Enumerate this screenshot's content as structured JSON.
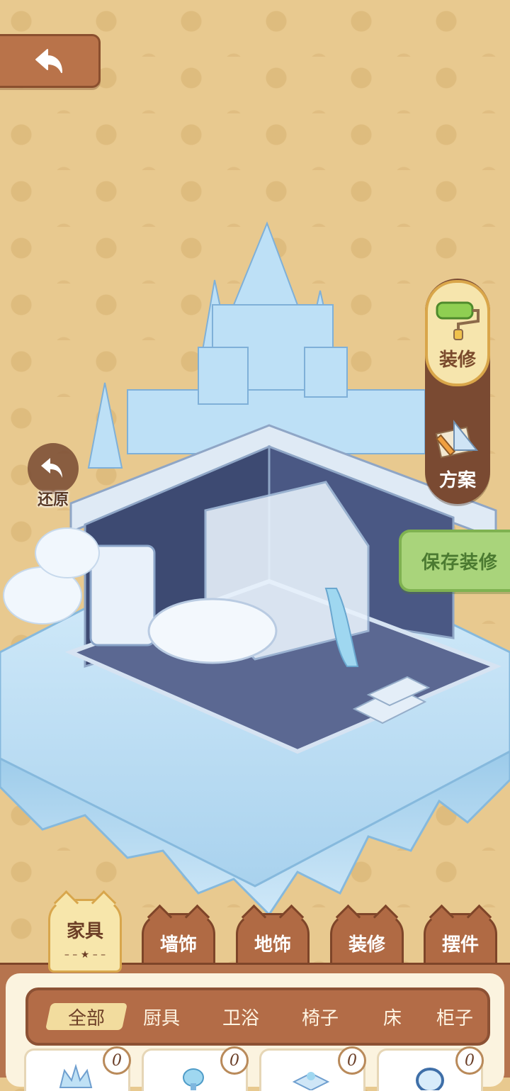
{
  "colors": {
    "background": "#e8c98f",
    "brown_button": "#b9734a",
    "active_tab": "#f7e6ab",
    "save_green": "#a9d47b",
    "ice_blue": "#bfe1f5"
  },
  "side_menu": {
    "renovate_label": "装修",
    "plan_label": "方案"
  },
  "restore_label": "还原",
  "save_label": "保存装修",
  "category_tabs": [
    {
      "label": "家具",
      "active": true
    },
    {
      "label": "墙饰",
      "active": false
    },
    {
      "label": "地饰",
      "active": false
    },
    {
      "label": "装修",
      "active": false
    },
    {
      "label": "摆件",
      "active": false
    }
  ],
  "sub_tabs": [
    {
      "label": "全部",
      "active": true
    },
    {
      "label": "厨具",
      "active": false
    },
    {
      "label": "卫浴",
      "active": false
    },
    {
      "label": "椅子",
      "active": false
    },
    {
      "label": "床",
      "active": false
    },
    {
      "label": "柜子",
      "active": false
    }
  ],
  "items": [
    {
      "count": "0",
      "icon": "ice-crown-icon"
    },
    {
      "count": "0",
      "icon": "ice-lamp-icon"
    },
    {
      "count": "0",
      "icon": "ice-bench-icon"
    },
    {
      "count": "0",
      "icon": "ice-mirror-icon"
    }
  ]
}
